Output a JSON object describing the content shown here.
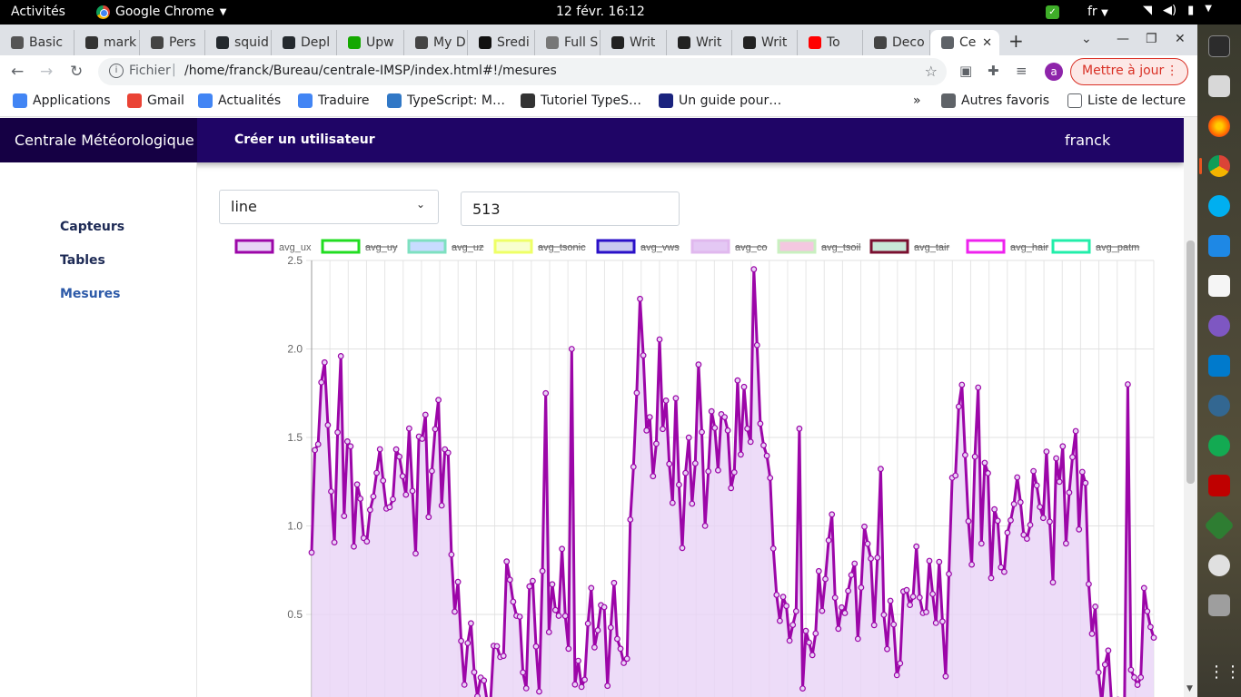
{
  "gnome": {
    "activities": "Activités",
    "app_name": "Google Chrome",
    "clock": "12 févr.  16:12",
    "lang": "fr"
  },
  "tabs": [
    {
      "label": "Basic",
      "color": "#555555"
    },
    {
      "label": "mark",
      "color": "#333333"
    },
    {
      "label": "Pers",
      "color": "#444444"
    },
    {
      "label": "squid",
      "color": "#24292e"
    },
    {
      "label": "Depl",
      "color": "#24292e"
    },
    {
      "label": "Upw",
      "color": "#14a800"
    },
    {
      "label": "My D",
      "color": "#444444"
    },
    {
      "label": "Sredi",
      "color": "#111111"
    },
    {
      "label": "Full S",
      "color": "#777777"
    },
    {
      "label": "Writ",
      "color": "#222222"
    },
    {
      "label": "Writ",
      "color": "#222222"
    },
    {
      "label": "Writ",
      "color": "#222222"
    },
    {
      "label": "To",
      "color": "#ff0000"
    },
    {
      "label": "Deco",
      "color": "#444444"
    },
    {
      "label": "Ce",
      "color": "#5f6368"
    }
  ],
  "address": {
    "scheme": "Fichier",
    "url": "/home/franck/Bureau/centrale-IMSP/index.html#!/mesures",
    "avatar_letter": "a",
    "update_label": "Mettre à jour"
  },
  "bookmarks": [
    {
      "label": "Applications",
      "color": "#4285f4"
    },
    {
      "label": "Gmail",
      "color": "#ea4335"
    },
    {
      "label": "Actualités",
      "color": "#4285f4"
    },
    {
      "label": "Traduire",
      "color": "#4285f4"
    },
    {
      "label": "TypeScript: M…",
      "color": "#3178c6"
    },
    {
      "label": "Tutoriel TypeS…",
      "color": "#333333"
    },
    {
      "label": "Un guide pour…",
      "color": "#1a237e"
    }
  ],
  "bookmarks_right": {
    "more": "»",
    "others": "Autres favoris",
    "reading_list": "Liste de lecture"
  },
  "navbar": {
    "brand": "Centrale Météorologique",
    "create_user": "Créer un utilisateur",
    "user": "franck"
  },
  "sidebar": {
    "items": [
      "Capteurs",
      "Tables",
      "Mesures"
    ]
  },
  "controls": {
    "chart_type": "line",
    "count_value": "513"
  },
  "chart_data": {
    "type": "line",
    "legend": [
      {
        "name": "avg_ux",
        "stroke": "#9c06a8",
        "fill": "#e8d3f6",
        "hidden": false
      },
      {
        "name": "avg_uy",
        "stroke": "#22dd22",
        "fill": "#ffffff",
        "hidden": true
      },
      {
        "name": "avg_uz",
        "stroke": "#7ee0c0",
        "fill": "#c8dcff",
        "hidden": true
      },
      {
        "name": "avg_tsonic",
        "stroke": "#eeff66",
        "fill": "#f8ffd0",
        "hidden": true
      },
      {
        "name": "avg_vws",
        "stroke": "#2a10c8",
        "fill": "#c9c9f0",
        "hidden": true
      },
      {
        "name": "avg_co",
        "stroke": "#e0b8ee",
        "fill": "#e4c8f4",
        "hidden": true
      },
      {
        "name": "avg_tsoil",
        "stroke": "#c9f0c0",
        "fill": "#f4c8e0",
        "hidden": true
      },
      {
        "name": "avg_tair",
        "stroke": "#7a1030",
        "fill": "#c8e8d8",
        "hidden": true
      },
      {
        "name": "avg_hair",
        "stroke": "#ee22ee",
        "fill": "#ffffff",
        "hidden": true
      },
      {
        "name": "avg_patm",
        "stroke": "#22eeaa",
        "fill": "#ffffff",
        "hidden": true
      }
    ],
    "yticks": [
      "2.5",
      "2.0",
      "1.5",
      "1.0",
      "0.5"
    ],
    "ylim": [
      0,
      2.5
    ],
    "grid": true,
    "series": [
      {
        "name": "avg_ux",
        "values": [
          0.85,
          1.28,
          1.5,
          1.95,
          1.85,
          1.45,
          1.3,
          1.0,
          1.4,
          1.9,
          1.2,
          1.5,
          1.3,
          0.9,
          1.38,
          1.1,
          0.8,
          1.0,
          1.2,
          1.05,
          1.22,
          1.57,
          1.3,
          0.95,
          1.1,
          1.3,
          1.4,
          1.25,
          1.35,
          1.3,
          1.45,
          1.1,
          0.97,
          1.57,
          1.35,
          1.6,
          1.2,
          1.3,
          1.4,
          1.76,
          1.25,
          1.35,
          1.3,
          0.95,
          0.6,
          0.55,
          0.3,
          0.25,
          0.35,
          0.3,
          0.2,
          0.18,
          0.08,
          0.0,
          0.1,
          0.05,
          0.2,
          0.25,
          0.4,
          0.3,
          0.65,
          0.7,
          0.72,
          0.45,
          0.35,
          0.25,
          0.2,
          0.55,
          0.6,
          0.45,
          0.12,
          0.6,
          0.8,
          0.55,
          0.65,
          0.38,
          0.55,
          1.0,
          0.4,
          0.2,
          0.25,
          0.18,
          0.1,
          0.05,
          0.28,
          0.45,
          0.5,
          0.35,
          0.55,
          0.48,
          0.42,
          0.2,
          0.52,
          0.55,
          0.3,
          0.45,
          0.25,
          0.1
        ],
        "segments": "primary"
      }
    ]
  }
}
